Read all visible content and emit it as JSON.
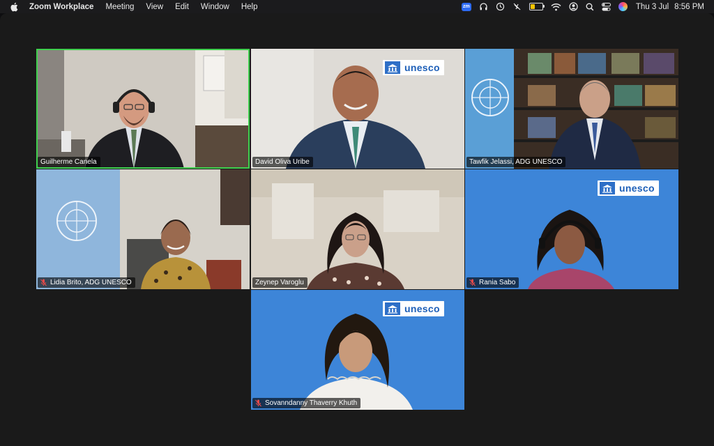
{
  "menubar": {
    "app_name": "Zoom Workplace",
    "menus": [
      "Meeting",
      "View",
      "Edit",
      "Window",
      "Help"
    ],
    "zoom_badge": "zm",
    "date": "Thu 3 Jul",
    "time": "8:56 PM",
    "status_icons": [
      "zoom-icon",
      "headphones-icon",
      "time-machine-icon",
      "do-not-disturb-icon",
      "battery-icon",
      "wifi-icon",
      "user-icon",
      "spotlight-search-icon",
      "control-center-icon",
      "siri-icon"
    ]
  },
  "meeting": {
    "participants": [
      {
        "name": "Guilherme Canela",
        "muted": false,
        "active_speaker": true
      },
      {
        "name": "David Oliva Uribe",
        "muted": false,
        "active_speaker": false
      },
      {
        "name": "Tawfik Jelassi, ADG UNESCO",
        "muted": false,
        "active_speaker": false
      },
      {
        "name": "Lidia Brito, ADG UNESCO",
        "muted": true,
        "active_speaker": false
      },
      {
        "name": "Zeynep Varoglu",
        "muted": false,
        "active_speaker": false
      },
      {
        "name": "Rania Sabo",
        "muted": true,
        "active_speaker": false
      },
      {
        "name": "Sovanndanny Thaverry Khuth",
        "muted": true,
        "active_speaker": false
      }
    ],
    "logo_text": "unesco"
  },
  "colors": {
    "active_speaker_border": "#3fcf4e",
    "unesco_blue": "#3d85d8",
    "mute_red": "#e24a4a"
  }
}
